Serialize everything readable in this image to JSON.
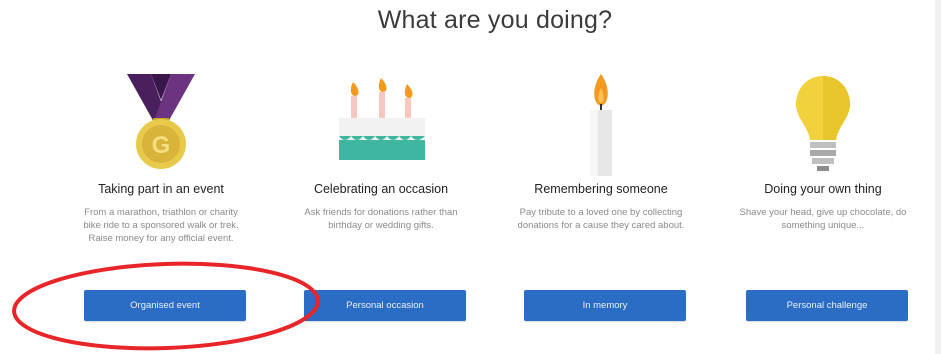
{
  "page": {
    "title": "What are you doing?"
  },
  "cards": [
    {
      "title": "Taking part in an event",
      "description": "From a marathon, triathlon or charity bike ride to a sponsored walk or trek. Raise money for any official event.",
      "button_label": "Organised event",
      "icon": "medal-icon"
    },
    {
      "title": "Celebrating an occasion",
      "description": "Ask friends for donations rather than birthday or wedding gifts.",
      "button_label": "Personal occasion",
      "icon": "cake-icon"
    },
    {
      "title": "Remembering someone",
      "description": "Pay tribute to a loved one by collecting donations for a cause they cared about.",
      "button_label": "In memory",
      "icon": "candle-icon"
    },
    {
      "title": "Doing your own thing",
      "description": "Shave your head, give up chocolate, do something unique...",
      "button_label": "Personal challenge",
      "icon": "lightbulb-icon"
    }
  ],
  "colors": {
    "button_bg": "#2b6cc4",
    "highlight": "#e8262a",
    "ribbon": "#5b2a6e",
    "gold": "#e8c94a",
    "cake": "#3fb6a0",
    "flame": "#f39a1e",
    "bulb": "#f2d23c"
  }
}
